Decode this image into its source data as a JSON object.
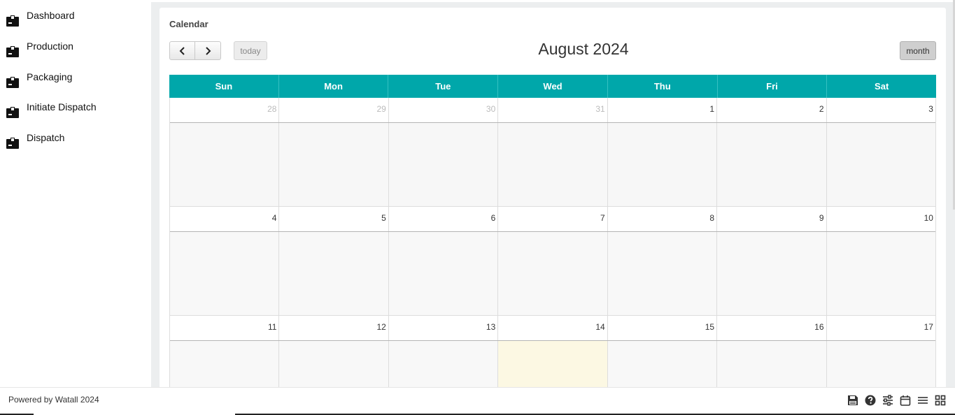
{
  "sidebar": {
    "items": [
      {
        "label": "Dashboard",
        "icon": "box-icon"
      },
      {
        "label": "Production",
        "icon": "box-icon"
      },
      {
        "label": "Packaging",
        "icon": "box-icon"
      },
      {
        "label": "Initiate Dispatch",
        "icon": "box-icon"
      },
      {
        "label": "Dispatch",
        "icon": "box-icon"
      }
    ]
  },
  "card": {
    "title": "Calendar"
  },
  "calendar": {
    "title": "August 2024",
    "today_label": "today",
    "month_label": "month",
    "header_color": "#00a7aa",
    "today_color": "#fcf8e3",
    "days": [
      "Sun",
      "Mon",
      "Tue",
      "Wed",
      "Thu",
      "Fri",
      "Sat"
    ],
    "weeks": [
      [
        "28",
        "29",
        "30",
        "31",
        "1",
        "2",
        "3"
      ],
      [
        "4",
        "5",
        "6",
        "7",
        "8",
        "9",
        "10"
      ],
      [
        "11",
        "12",
        "13",
        "14",
        "15",
        "16",
        "17"
      ]
    ],
    "other_month_first_week": 4,
    "today_date": "14"
  },
  "footer": {
    "text": "Powered by Watall 2024",
    "icons": [
      "save-icon",
      "help-icon",
      "sliders-icon",
      "calendar-icon",
      "menu-icon",
      "grid-icon"
    ]
  }
}
